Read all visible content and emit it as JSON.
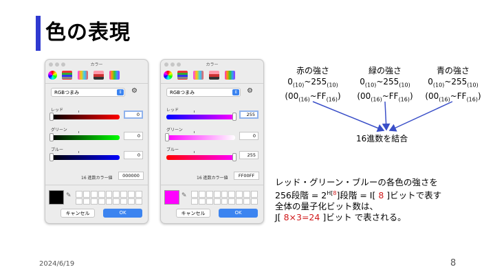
{
  "slide": {
    "title": "色の表現",
    "date": "2024/6/19",
    "page_number": "8"
  },
  "picker_common": {
    "window_title": "カラー",
    "mode_select": "RGBつまみ",
    "label_red": "レッド",
    "label_green": "グリーン",
    "label_blue": "ブルー",
    "hex_label": "16 進数カラー値",
    "cancel": "キャンセル",
    "ok": "OK"
  },
  "picker_left": {
    "red": "0",
    "green": "0",
    "blue": "0",
    "hex": "000000",
    "swatch_color": "#000000"
  },
  "picker_right": {
    "red": "255",
    "green": "0",
    "blue": "255",
    "hex": "FF00FF",
    "swatch_color": "#ff00ff"
  },
  "labels": {
    "red_title": "赤の強さ",
    "green_title": "緑の強さ",
    "blue_title": "青の強さ",
    "range_min": "0",
    "range_max": "~255",
    "sub10": "(10)",
    "hex_min": "(00",
    "hex_max": "~FF",
    "sub16": "(16)",
    "close_paren": ")",
    "combine": "16進数を結合"
  },
  "description": {
    "line1": "レッド・グリーン・ブルーの各色の強さを",
    "line2_a": "256段階 = 2",
    "line2_b": "H[",
    "line2_c": "8",
    "line2_d": "]段階 = I[",
    "line2_e": "8",
    "line2_f": "]ビットで表す",
    "line3": "全体の量子化ビット数は、",
    "line4_a": "J[",
    "line4_b": "8×3=24",
    "line4_c": "]ビット で表される。"
  },
  "colors": {
    "accent": "#2f3ad0",
    "ok_button": "#3c84f0",
    "highlight_red": "#d0181a"
  }
}
